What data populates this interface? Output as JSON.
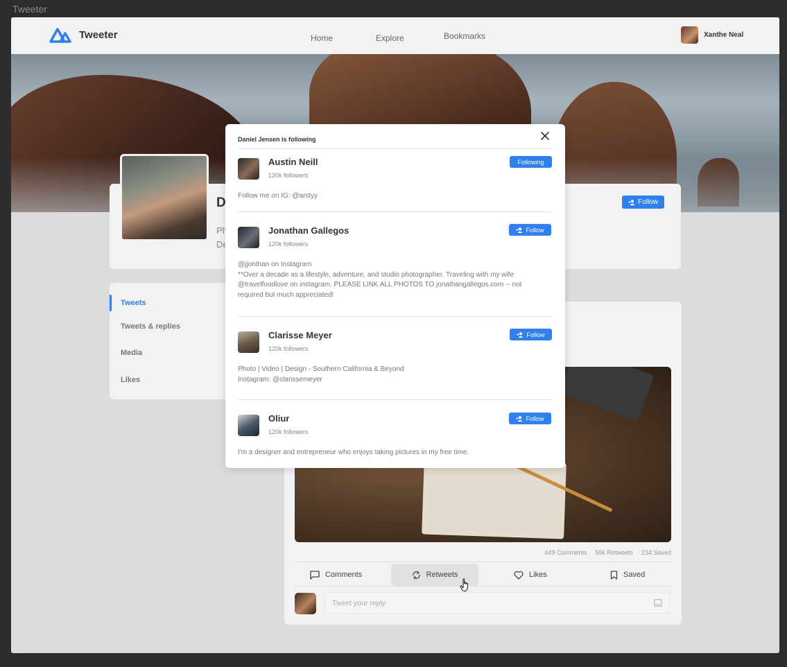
{
  "frame_title": "Tweeter",
  "brand": {
    "name": "Tweeter",
    "accent": "#2f80ed"
  },
  "nav": {
    "home": "Home",
    "explore": "Explore",
    "bookmarks": "Bookmarks"
  },
  "current_user": {
    "name": "Xanthe Neal"
  },
  "profile": {
    "name_partial": "D",
    "bio_line1_partial": "Ph",
    "bio_line2_partial": "De",
    "follow_label": "Follow"
  },
  "sidebar": {
    "items": [
      {
        "label": "Tweets",
        "active": true
      },
      {
        "label": "Tweets & replies",
        "active": false
      },
      {
        "label": "Media",
        "active": false
      },
      {
        "label": "Likes",
        "active": false
      }
    ]
  },
  "post": {
    "stats": {
      "comments": "449 Comments",
      "retweets": "59k Retweets",
      "saved": "234 Saved"
    },
    "actions": {
      "comments": "Comments",
      "retweets": "Retweets",
      "likes": "Likes",
      "saved": "Saved"
    },
    "reply_placeholder": "Tweet your reply"
  },
  "modal": {
    "title": "Daniel Jensen is following",
    "users": [
      {
        "name": "Austin Neill",
        "followers": "120k followers",
        "button": "Following",
        "bio": "Follow me on IG: @arstyy"
      },
      {
        "name": "Jonathan Gallegos",
        "followers": "120k followers",
        "button": "Follow",
        "bio": "@jjonthan on Instagram\n**Over a decade as a lifestyle, adventure, and studio photographer. Traveling with my wife\n@travelfoodlove on instagram. PLEASE LINK ALL PHOTOS TO jonathangallegos.com -- not\nrequired but much appreciated!"
      },
      {
        "name": "Clarisse Meyer",
        "followers": "120k followers",
        "button": "Follow",
        "bio": "Photo | Video | Design - Southern California & Beyond\nInstagram: @clarissemeyer"
      },
      {
        "name": "Oliur",
        "followers": "120k followers",
        "button": "Follow",
        "bio": "I'm a designer and entrepreneur who enjoys taking pictures in my free time."
      }
    ]
  }
}
